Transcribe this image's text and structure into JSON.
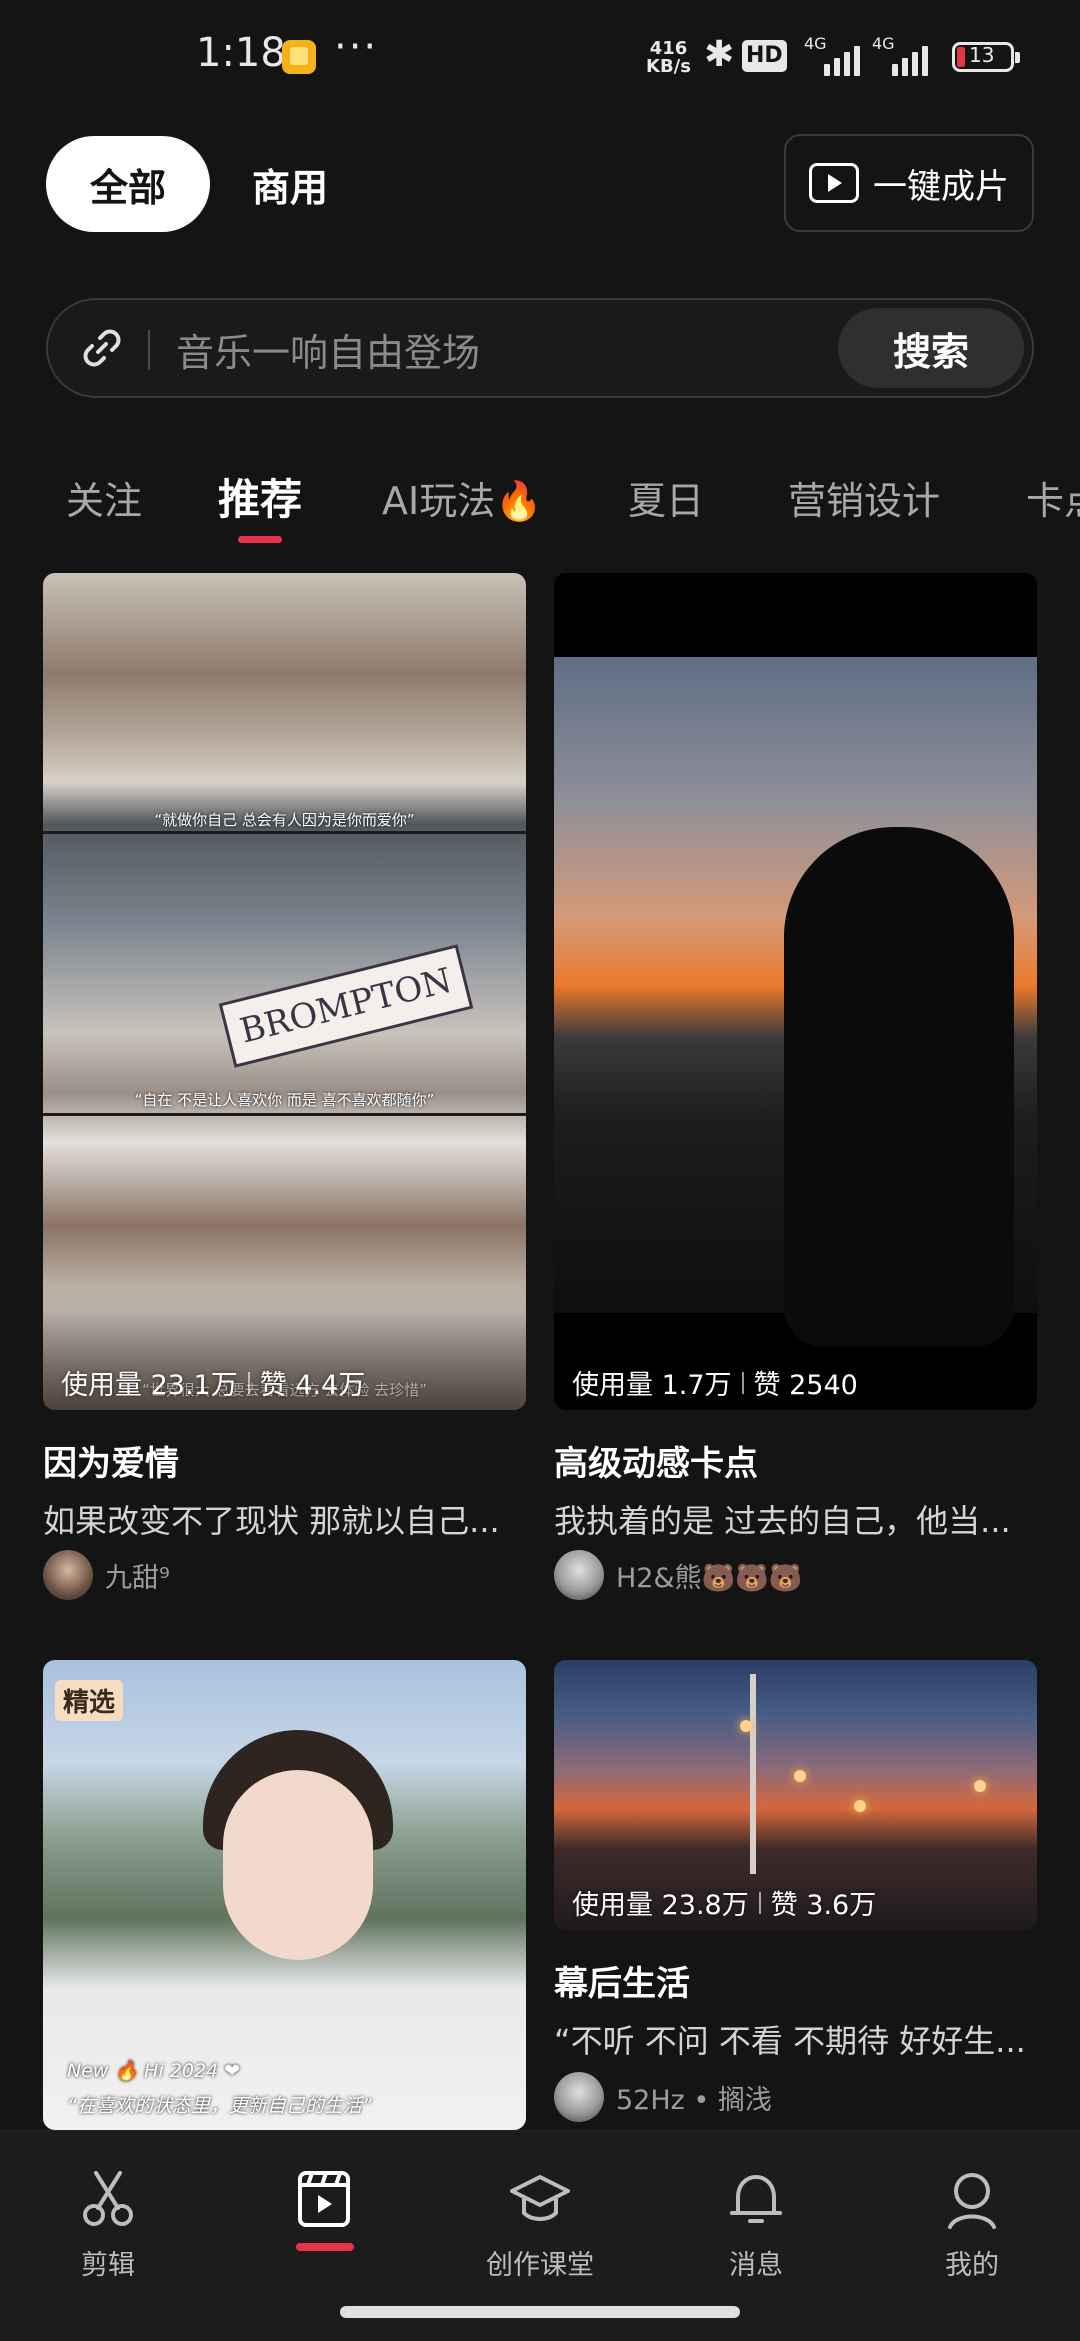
{
  "status_bar": {
    "time": "1:18",
    "net_speed_value": "416",
    "net_speed_unit": "KB/s",
    "hd_label": "HD",
    "net_type_1": "4G",
    "net_type_2": "4G",
    "battery": "13",
    "more": "···"
  },
  "top": {
    "toggle_all": "全部",
    "toggle_business": "商用",
    "one_click": "一键成片"
  },
  "search": {
    "placeholder": "音乐一响自由登场",
    "button": "搜索"
  },
  "tabs": [
    "关注",
    "推荐",
    "AI玩法🔥",
    "夏日",
    "营销设计",
    "卡点"
  ],
  "cards": [
    {
      "captions": [
        "“就做你自己 总会有人因为是你而爱你”",
        "“自在 不是让人喜欢你 而是 喜不喜欢都随你”",
        "“世界很大 总要去看看远方 去体验 去珍惜”"
      ],
      "sign_text": "BROMPTON",
      "usage": "使用量 23.1万",
      "likes": "赞 4.4万",
      "title": "因为爱情",
      "desc": "如果改变不了现状 那就以自己...",
      "author": "九甜⁹"
    },
    {
      "usage": "使用量 1.7万",
      "likes": "赞 2540",
      "title": "高级动感卡点",
      "desc": "我执着的是 过去的自己，他当...",
      "author": "H2&熊🐻🐻🐻"
    },
    {
      "badge": "精选",
      "overlay": "“在喜欢的状态里，更新自己的生活”",
      "overlay_small": "New 🔥 Hi 2024 ❤",
      "title": "",
      "desc": "",
      "author": ""
    },
    {
      "usage": "使用量 23.8万",
      "likes": "赞 3.6万",
      "title": "幕后生活",
      "desc": "“不听 不问 不看 不期待 好好生...",
      "author": "52Hz • 搁浅"
    }
  ],
  "bottom_nav": [
    "剪辑",
    "",
    "创作课堂",
    "消息",
    "我的"
  ],
  "colors": {
    "accent": "#e8324a",
    "background": "#141414"
  }
}
